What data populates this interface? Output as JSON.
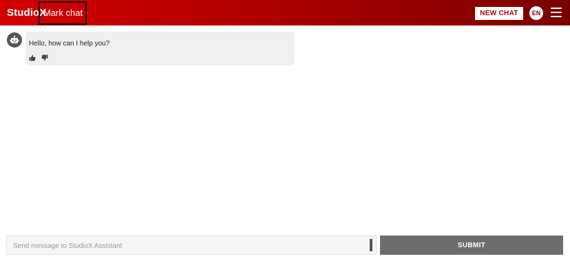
{
  "header": {
    "brand": "StudioX",
    "chat_title": "Mark chat",
    "new_chat_label": "NEW CHAT",
    "language": "EN",
    "colors": {
      "gradient_start": "#d40000",
      "gradient_end": "#7a0000"
    }
  },
  "conversation": {
    "messages": [
      {
        "sender": "bot",
        "text": "Hello, how can I help you?"
      }
    ]
  },
  "composer": {
    "placeholder": "Send message to StudioX Assistant",
    "value": "",
    "submit_label": "SUBMIT"
  },
  "icons": {
    "avatar": "robot-icon",
    "like": "thumbs-up-icon",
    "dislike": "thumbs-down-icon",
    "menu": "hamburger-menu-icon"
  }
}
